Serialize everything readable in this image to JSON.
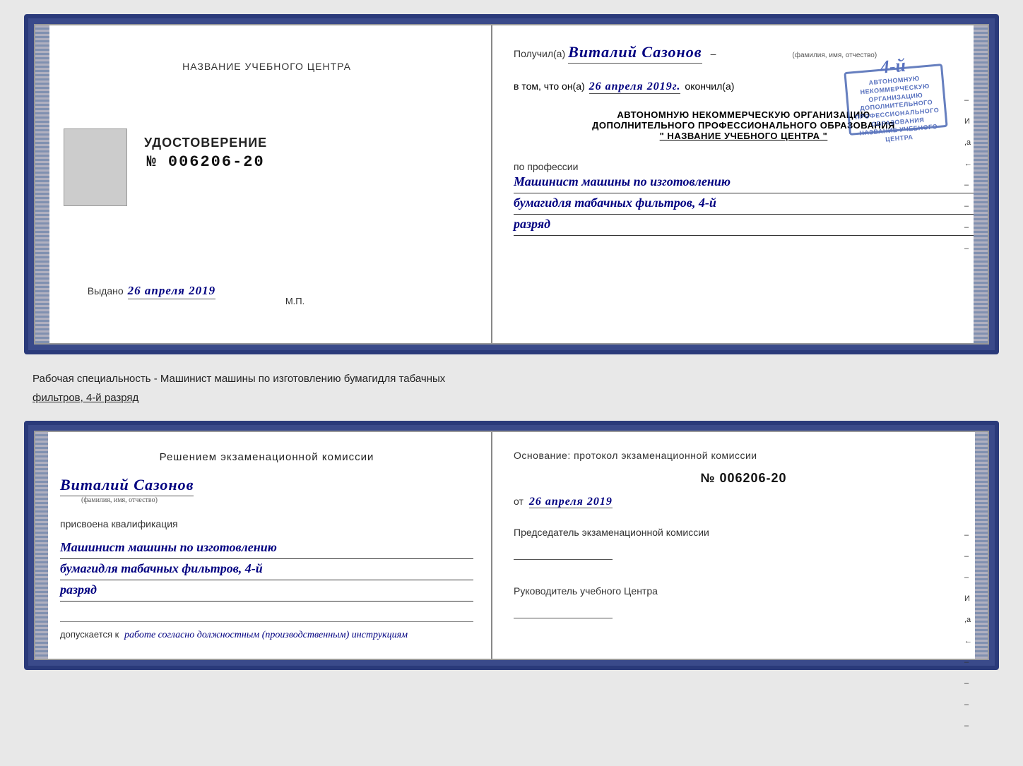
{
  "cert": {
    "left": {
      "header": "НАЗВАНИЕ УЧЕБНОГО ЦЕНТРА",
      "udostoverenie": "УДОСТОВЕРЕНИЕ",
      "number": "№ 006206-20",
      "issued_label": "Выдано",
      "issued_date": "26 апреля 2019",
      "mp": "М.П."
    },
    "right": {
      "poluchil": "Получил(а)",
      "name_handwritten": "Виталий Сазонов",
      "name_sub": "(фамилия, имя, отчество)",
      "vtom": "в том, что он(а)",
      "date_handwritten": "26 апреля 2019г.",
      "okonchil": "окончил(а)",
      "org_line1": "АВТОНОМНУЮ НЕКОММЕРЧЕСКУЮ ОРГАНИЗАЦИЮ",
      "org_line2": "ДОПОЛНИТЕЛЬНОГО ПРОФЕССИОНАЛЬНОГО ОБРАЗОВАНИЯ",
      "org_name": "\"  НАЗВАНИЕ УЧЕБНОГО ЦЕНТРА  \"",
      "po_professii": "по профессии",
      "profession_line1": "Машинист машины по изготовлению",
      "profession_line2": "бумагидля табачных фильтров, 4-й",
      "profession_line3": "разряд",
      "side_marks": [
        "-",
        "И",
        ",а",
        "←",
        "-",
        "-",
        "-",
        "-"
      ]
    }
  },
  "caption": {
    "text1": "Рабочая специальность - Машинист машины по изготовлению бумагидля табачных",
    "text2": "фильтров, 4-й разряд"
  },
  "exam": {
    "left": {
      "heading": "Решением  экзаменационной  комиссии",
      "name_handwritten": "Виталий Сазонов",
      "name_sub": "(фамилия, имя, отчество)",
      "prisvoena": "присвоена квалификация",
      "qual_line1": "Машинист машины по изготовлению",
      "qual_line2": "бумагидля табачных фильтров, 4-й",
      "qual_line3": "разряд",
      "dopuskaetsya": "допускается к",
      "dopusk_text": "работе согласно должностным (производственным) инструкциям"
    },
    "right": {
      "osnovanie": "Основание: протокол экзаменационной  комиссии",
      "number": "№  006206-20",
      "ot_label": "от",
      "date": "26 апреля 2019",
      "predsedatel_label": "Председатель экзаменационной комиссии",
      "rukovoditel_label": "Руководитель учебного Центра",
      "side_marks": [
        "-",
        "-",
        "-",
        "И",
        ",а",
        "←",
        "-",
        "-",
        "-",
        "-"
      ]
    }
  }
}
